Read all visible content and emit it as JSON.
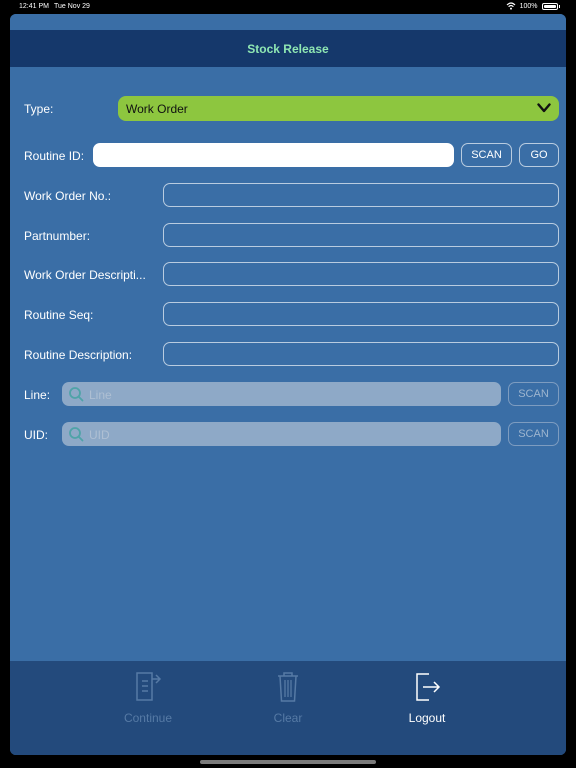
{
  "status_bar": {
    "time": "12:41 PM",
    "date": "Tue Nov 29",
    "battery": "100%"
  },
  "header": {
    "title": "Stock Release"
  },
  "form": {
    "type": {
      "label": "Type:",
      "value": "Work Order"
    },
    "routine_id": {
      "label": "Routine ID:",
      "value": "",
      "scan": "SCAN",
      "go": "GO"
    },
    "work_order_no": {
      "label": "Work Order No.:",
      "value": ""
    },
    "partnumber": {
      "label": "Partnumber:",
      "value": ""
    },
    "work_order_description": {
      "label": "Work Order Descripti...",
      "value": ""
    },
    "routine_seq": {
      "label": "Routine Seq:",
      "value": ""
    },
    "routine_description": {
      "label": "Routine Description:",
      "value": ""
    },
    "line": {
      "label": "Line:",
      "placeholder": "Line",
      "scan": "SCAN"
    },
    "uid": {
      "label": "UID:",
      "placeholder": "UID",
      "scan": "SCAN"
    }
  },
  "toolbar": {
    "continue": {
      "label": "Continue",
      "icon": "continue-document-icon",
      "enabled": false
    },
    "clear": {
      "label": "Clear",
      "icon": "trash-icon",
      "enabled": false
    },
    "logout": {
      "label": "Logout",
      "icon": "logout-icon",
      "enabled": true
    }
  },
  "colors": {
    "background": "#3a6ea6",
    "title_bar": "#15386b",
    "title_text": "#8fe7b3",
    "select_green": "#8dc63f",
    "toolbar": "#234a7c"
  }
}
